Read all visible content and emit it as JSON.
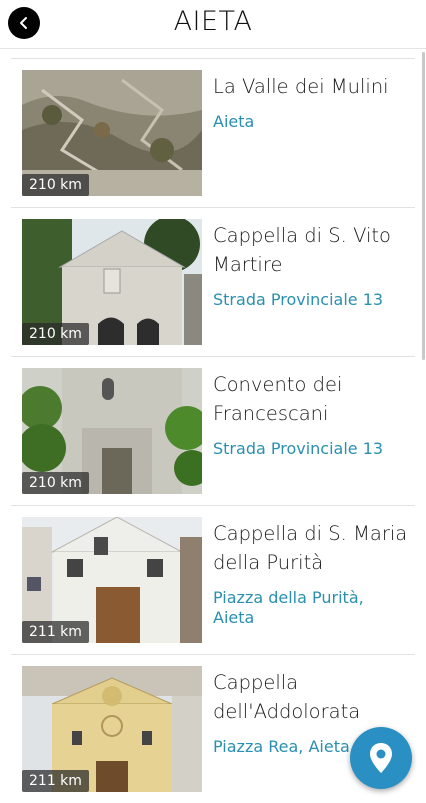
{
  "header": {
    "title": "AIETA",
    "back_icon": "chevron-left-icon"
  },
  "places": [
    {
      "name": "La Valle dei Mulini",
      "location": "Aieta",
      "distance": "210 km"
    },
    {
      "name": "Cappella di S. Vito Martire",
      "location": "Strada Provinciale 13",
      "distance": "210 km"
    },
    {
      "name": "Convento dei Francescani",
      "location": "Strada Provinciale 13",
      "distance": "210 km"
    },
    {
      "name": "Cappella di S. Maria della Purità",
      "location": "Piazza della Purità, Aieta",
      "distance": "211 km"
    },
    {
      "name": "Cappella dell'Addolorata",
      "location": "Piazza Rea, Aieta",
      "distance": "211 km"
    }
  ],
  "fab": {
    "icon": "map-pin-icon"
  },
  "colors": {
    "accent": "#2a90c4",
    "location_text": "#2a8fb0",
    "header_text": "#111111"
  }
}
